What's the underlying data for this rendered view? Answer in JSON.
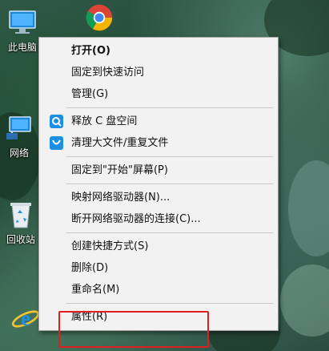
{
  "desktop": {
    "icons": [
      {
        "label": "此电脑",
        "icon": "this-pc-icon"
      },
      {
        "label": "网络",
        "icon": "network-icon"
      },
      {
        "label": "回收站",
        "icon": "recycle-bin-icon"
      },
      {
        "label": "",
        "icon": "internet-explorer-icon"
      },
      {
        "label": "",
        "icon": "chrome-icon"
      }
    ]
  },
  "context_menu": {
    "items": [
      {
        "label": "打开(O)",
        "bold": true
      },
      {
        "label": "固定到快速访问"
      },
      {
        "label": "管理(G)"
      },
      {
        "label": "释放 C 盘空间",
        "icon": "cleanup-app-icon"
      },
      {
        "label": "清理大文件/重复文件",
        "icon": "cleanup-app-icon-2"
      },
      {
        "label": "固定到\"开始\"屏幕(P)"
      },
      {
        "label": "映射网络驱动器(N)..."
      },
      {
        "label": "断开网络驱动器的连接(C)..."
      },
      {
        "label": "创建快捷方式(S)"
      },
      {
        "label": "删除(D)"
      },
      {
        "label": "重命名(M)"
      },
      {
        "label": "属性(R)"
      }
    ]
  },
  "colors": {
    "menu_bg": "#f2f2f2",
    "highlight_red": "#e02020",
    "app_icon_blue": "#1a8fe3"
  }
}
